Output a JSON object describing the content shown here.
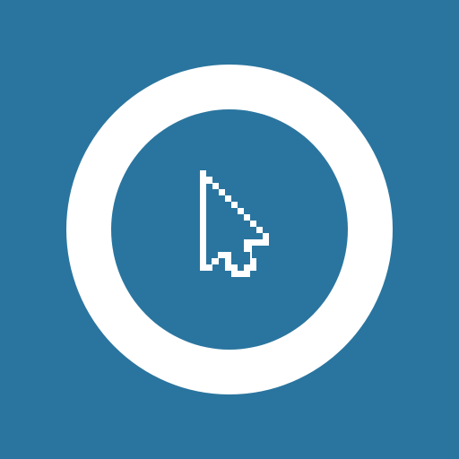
{
  "app": {
    "background_color": "#2a759f",
    "foreground_color": "#ffffff"
  },
  "icon": {
    "ring": "circle-ring-icon",
    "cursor": "pixel-arrow-cursor-icon"
  }
}
